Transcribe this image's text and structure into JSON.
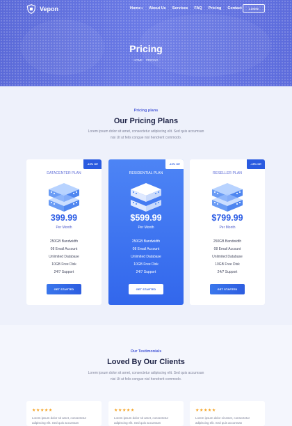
{
  "nav": {
    "logo": "Vepon",
    "items": [
      {
        "label": "Home",
        "dropdown": true
      },
      {
        "label": "About Us"
      },
      {
        "label": "Services"
      },
      {
        "label": "FAQ"
      },
      {
        "label": "Pricing"
      },
      {
        "label": "Contact"
      }
    ],
    "login": "LOGIN"
  },
  "hero": {
    "title": "Pricing",
    "breadcrumb": [
      "HOME",
      "PRICING"
    ]
  },
  "pricing": {
    "tag": "Pricing plans",
    "title": "Our Pricing Plans",
    "description": "Lorem ipsum dolor sit amet, consectetur adipiscing elit. Sed quis accumsan nisi Ut ut felis congue nisl hendrerit commodo.",
    "plans": [
      {
        "name": "DATACENTER PLAN",
        "badge": "-10% Off",
        "price": "399.99",
        "period": "Per Month",
        "features": [
          "250GB Bandwidth",
          "08 Email Account",
          "Unlimited Database",
          "10GB Free Disk",
          "24/7 Support"
        ],
        "cta": "GET STARTED"
      },
      {
        "name": "RESIDENTIAL PLAN",
        "badge": "-10% Off",
        "price": "$599.99",
        "period": "Per Month",
        "features": [
          "250GB Bandwidth",
          "08 Email Account",
          "Unlimited Database",
          "10GB Free Disk",
          "24/7 Support"
        ],
        "cta": "GET STARTED"
      },
      {
        "name": "RESELLER PLAN",
        "badge": "-15% Off",
        "price": "$799.99",
        "period": "Per Month",
        "features": [
          "250GB Bandwidth",
          "08 Email Account",
          "Unlimited Database",
          "10GB Free Disk",
          "24/7 Support"
        ],
        "cta": "GET STARTED"
      }
    ]
  },
  "testimonials": {
    "tag": "Our Testimonials",
    "title": "Loved By Our Clients",
    "description": "Lorem ipsum dolor sit amet, consectetur adipiscing elit. Sed quis accumsan nisi Ut ut felis congue nisl hendrerit commodo.",
    "reviews": [
      {
        "stars": "★★★★★",
        "text": "Lorem ipsum dolor sit amet, consectetur adipiscing elit. Sed quis accumsan"
      },
      {
        "stars": "★★★★★",
        "text": "Lorem ipsum dolor sit amet, consectetur adipiscing elit. Sed quis accumsan"
      },
      {
        "stars": "★★★★★",
        "text": "Lorem ipsum dolor sit amet, consectetur adipiscing elit. Sed quis accumsan"
      }
    ]
  },
  "colors": {
    "accent": "#3267ec",
    "hero": "#6a7ae6",
    "star": "#f4a01d"
  }
}
